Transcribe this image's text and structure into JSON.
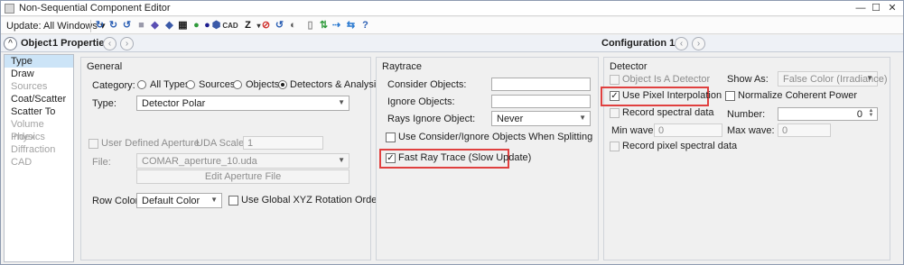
{
  "window": {
    "title": "Non-Sequential Component Editor",
    "min": "—",
    "max": "☐",
    "close": "✕"
  },
  "toolbar": {
    "update_label": "Update: All Windows",
    "update_arrow": "▾",
    "cad_label": "CAD",
    "z_label": "Z"
  },
  "header": {
    "object_label": "Object",
    "properties_label": "1 Properties",
    "prev": "‹",
    "next": "›",
    "configuration_label": "Configuration 1/1",
    "collapse": "^"
  },
  "sidebar": {
    "items": [
      {
        "label": "Type"
      },
      {
        "label": "Draw"
      },
      {
        "label": "Sources"
      },
      {
        "label": "Coat/Scatter"
      },
      {
        "label": "Scatter To"
      },
      {
        "label": "Volume Physics"
      },
      {
        "label": "Index"
      },
      {
        "label": "Diffraction"
      },
      {
        "label": "CAD"
      }
    ]
  },
  "general": {
    "heading": "General",
    "category_label": "Category:",
    "category_options": [
      "All Types",
      "Sources",
      "Objects",
      "Detectors & Analysis"
    ],
    "type_label": "Type:",
    "type_value": "Detector Polar",
    "uda_checkbox_label": "User Defined Aperture",
    "uda_scale_label": "UDA Scale:",
    "uda_scale_value": "1",
    "file_label": "File:",
    "file_value": "COMAR_aperture_10.uda",
    "edit_aperture_button": "Edit Aperture File",
    "row_color_label": "Row Color:",
    "row_color_value": "Default Color",
    "global_xyz_label": "Use Global XYZ Rotation Order"
  },
  "raytrace": {
    "heading": "Raytrace",
    "consider_objects_label": "Consider Objects:",
    "consider_objects_value": "",
    "ignore_objects_label": "Ignore Objects:",
    "ignore_objects_value": "",
    "rays_ignore_label": "Rays Ignore Object:",
    "rays_ignore_value": "Never",
    "use_consider_label": "Use Consider/Ignore Objects When Splitting",
    "fast_ray_trace_label": "Fast Ray Trace (Slow Update)",
    "fast_ray_trace_checked": "✓"
  },
  "detector": {
    "heading": "Detector",
    "object_is_detector_label": "Object Is A Detector",
    "use_pixel_interp_label": "Use Pixel Interpolation",
    "use_pixel_interp_checked": "✓",
    "record_spectral_label": "Record spectral data",
    "min_wave_label": "Min wave:",
    "min_wave_value": "0",
    "record_pixel_spectral_label": "Record pixel spectral data",
    "show_as_label": "Show As:",
    "show_as_value": "False Color (Irradiance)",
    "normalize_label": "Normalize Coherent Power",
    "number_label": "Number:",
    "number_value": "0",
    "max_wave_label": "Max wave:",
    "max_wave_value": "0"
  },
  "colors": {
    "highlight": "#e0403f",
    "selected": "#cce4f7"
  }
}
